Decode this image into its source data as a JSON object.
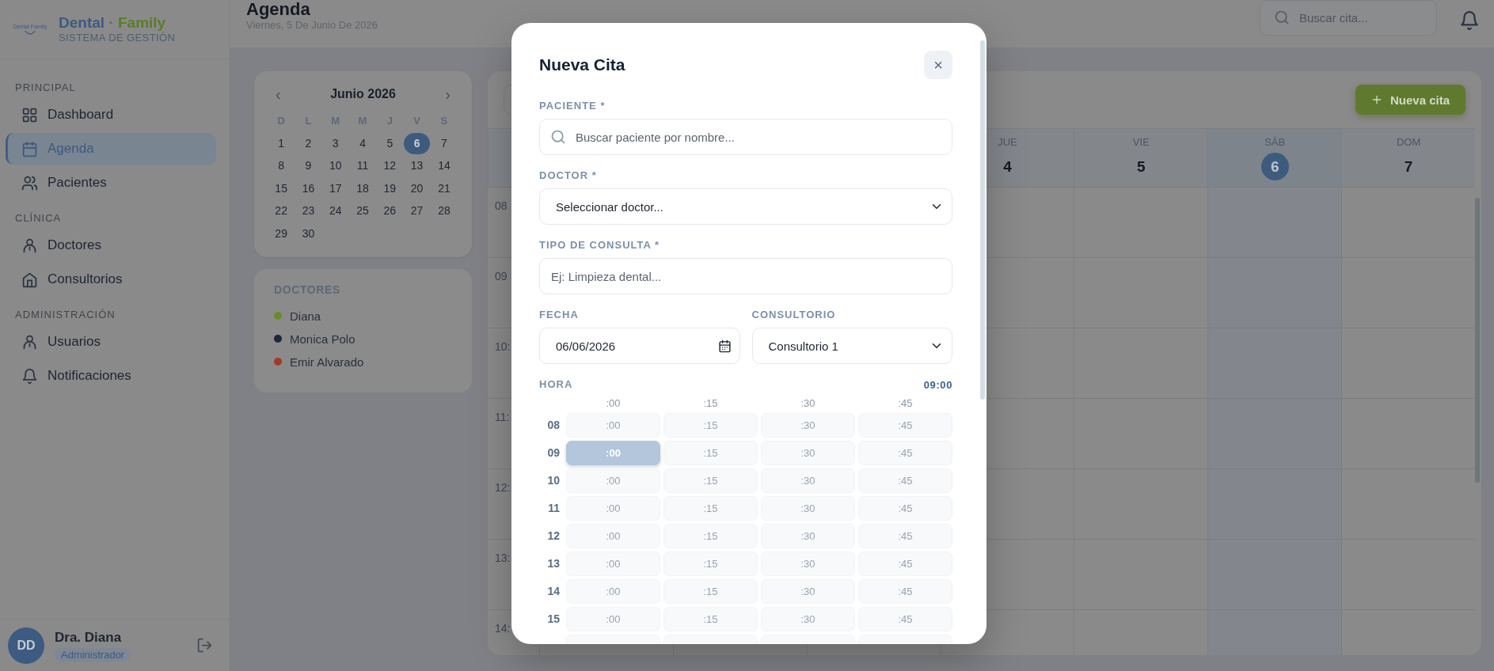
{
  "sidebar": {
    "logo_text": "Dental Family",
    "brand": {
      "parts": [
        {
          "text": "Dental",
          "color": "#3d5a80"
        },
        {
          "text": "·",
          "color": "#5e6670"
        },
        {
          "text": "Family",
          "color": "#5c7c26"
        }
      ],
      "subtitle": "SISTEMA DE GESTIÓN"
    },
    "sections": [
      {
        "title": "PRINCIPAL",
        "items": [
          {
            "label": "Dashboard",
            "kind": "grid",
            "selected": false
          },
          {
            "label": "Agenda",
            "kind": "calendar",
            "selected": true
          },
          {
            "label": "Pacientes",
            "kind": "users",
            "selected": false
          }
        ]
      },
      {
        "title": "CLÍNICA",
        "items": [
          {
            "label": "Doctores",
            "kind": "person",
            "selected": false
          },
          {
            "label": "Consultorios",
            "kind": "home",
            "selected": false
          }
        ]
      },
      {
        "title": "ADMINISTRACIÓN",
        "items": [
          {
            "label": "Usuarios",
            "kind": "person",
            "selected": false
          },
          {
            "label": "Notificaciones",
            "kind": "bell",
            "selected": false
          }
        ]
      }
    ],
    "user": {
      "initials": "DD",
      "name": "Dra. Diana",
      "role": "Administrador"
    }
  },
  "header": {
    "title": "Agenda",
    "subtitle": "Viernes, 5 De Junio De 2026",
    "search": {
      "placeholder": "Buscar cita..."
    }
  },
  "mini_calendar": {
    "month": "Junio 2026",
    "prev": "‹",
    "next": "›",
    "weekdays": [
      "D",
      "L",
      "M",
      "M",
      "J",
      "V",
      "S"
    ],
    "days": [
      {
        "label": "1",
        "selected": false
      },
      {
        "label": "2",
        "selected": false
      },
      {
        "label": "3",
        "selected": false
      },
      {
        "label": "4",
        "selected": false
      },
      {
        "label": "5",
        "selected": false
      },
      {
        "label": "6",
        "selected": true
      },
      {
        "label": "7",
        "selected": false
      },
      {
        "label": "8",
        "selected": false
      },
      {
        "label": "9",
        "selected": false
      },
      {
        "label": "10",
        "selected": false
      },
      {
        "label": "11",
        "selected": false
      },
      {
        "label": "12",
        "selected": false
      },
      {
        "label": "13",
        "selected": false
      },
      {
        "label": "14",
        "selected": false
      },
      {
        "label": "15",
        "selected": false
      },
      {
        "label": "16",
        "selected": false
      },
      {
        "label": "17",
        "selected": false
      },
      {
        "label": "18",
        "selected": false
      },
      {
        "label": "19",
        "selected": false
      },
      {
        "label": "20",
        "selected": false
      },
      {
        "label": "21",
        "selected": false
      },
      {
        "label": "22",
        "selected": false
      },
      {
        "label": "23",
        "selected": false
      },
      {
        "label": "24",
        "selected": false
      },
      {
        "label": "25",
        "selected": false
      },
      {
        "label": "26",
        "selected": false
      },
      {
        "label": "27",
        "selected": false
      },
      {
        "label": "28",
        "selected": false
      },
      {
        "label": "29",
        "selected": false
      },
      {
        "label": "30",
        "selected": false
      }
    ]
  },
  "doctors": {
    "title": "DOCTORES",
    "items": [
      {
        "name": "Diana",
        "color": "#6b8a2a"
      },
      {
        "name": "Monica Polo",
        "color": "#1e2533"
      },
      {
        "name": "Emir Alvarado",
        "color": "#a3392a"
      }
    ]
  },
  "agenda": {
    "button": "Nueva cita",
    "days": [
      {
        "name": "JUE",
        "number": "4",
        "selected": false
      },
      {
        "name": "VIE",
        "number": "5",
        "selected": false
      },
      {
        "name": "SÁB",
        "number": "6",
        "selected": true
      },
      {
        "name": "DOM",
        "number": "7",
        "selected": false
      }
    ],
    "times": [
      "08",
      "09",
      "10:",
      "11:",
      "12:",
      "13:",
      "14:"
    ]
  },
  "modal": {
    "title": "Nueva Cita",
    "close": "×",
    "patient": {
      "label": "PACIENTE *",
      "placeholder": "Buscar paciente por nombre..."
    },
    "doctor": {
      "label": "DOCTOR *",
      "value": "Seleccionar doctor..."
    },
    "type": {
      "label": "TIPO DE CONSULTA *",
      "placeholder": "Ej: Limpieza dental..."
    },
    "date": {
      "label": "FECHA",
      "value": "06/06/2026"
    },
    "room": {
      "label": "CONSULTORIO",
      "value": "Consultorio 1"
    },
    "time": {
      "label": "HORA",
      "value": "09:00",
      "minutes": [
        ":00",
        ":15",
        ":30",
        ":45"
      ],
      "hours": [
        {
          "label": "08",
          "slots": [
            {
              "label": ":00",
              "selected": false
            },
            {
              "label": ":15",
              "selected": false
            },
            {
              "label": ":30",
              "selected": false
            },
            {
              "label": ":45",
              "selected": false
            }
          ]
        },
        {
          "label": "09",
          "slots": [
            {
              "label": ":00",
              "selected": true
            },
            {
              "label": ":15",
              "selected": false
            },
            {
              "label": ":30",
              "selected": false
            },
            {
              "label": ":45",
              "selected": false
            }
          ]
        },
        {
          "label": "10",
          "slots": [
            {
              "label": ":00",
              "selected": false
            },
            {
              "label": ":15",
              "selected": false
            },
            {
              "label": ":30",
              "selected": false
            },
            {
              "label": ":45",
              "selected": false
            }
          ]
        },
        {
          "label": "11",
          "slots": [
            {
              "label": ":00",
              "selected": false
            },
            {
              "label": ":15",
              "selected": false
            },
            {
              "label": ":30",
              "selected": false
            },
            {
              "label": ":45",
              "selected": false
            }
          ]
        },
        {
          "label": "12",
          "slots": [
            {
              "label": ":00",
              "selected": false
            },
            {
              "label": ":15",
              "selected": false
            },
            {
              "label": ":30",
              "selected": false
            },
            {
              "label": ":45",
              "selected": false
            }
          ]
        },
        {
          "label": "13",
          "slots": [
            {
              "label": ":00",
              "selected": false
            },
            {
              "label": ":15",
              "selected": false
            },
            {
              "label": ":30",
              "selected": false
            },
            {
              "label": ":45",
              "selected": false
            }
          ]
        },
        {
          "label": "14",
          "slots": [
            {
              "label": ":00",
              "selected": false
            },
            {
              "label": ":15",
              "selected": false
            },
            {
              "label": ":30",
              "selected": false
            },
            {
              "label": ":45",
              "selected": false
            }
          ]
        },
        {
          "label": "15",
          "slots": [
            {
              "label": ":00",
              "selected": false
            },
            {
              "label": ":15",
              "selected": false
            },
            {
              "label": ":30",
              "selected": false
            },
            {
              "label": ":45",
              "selected": false
            }
          ]
        }
      ]
    }
  }
}
